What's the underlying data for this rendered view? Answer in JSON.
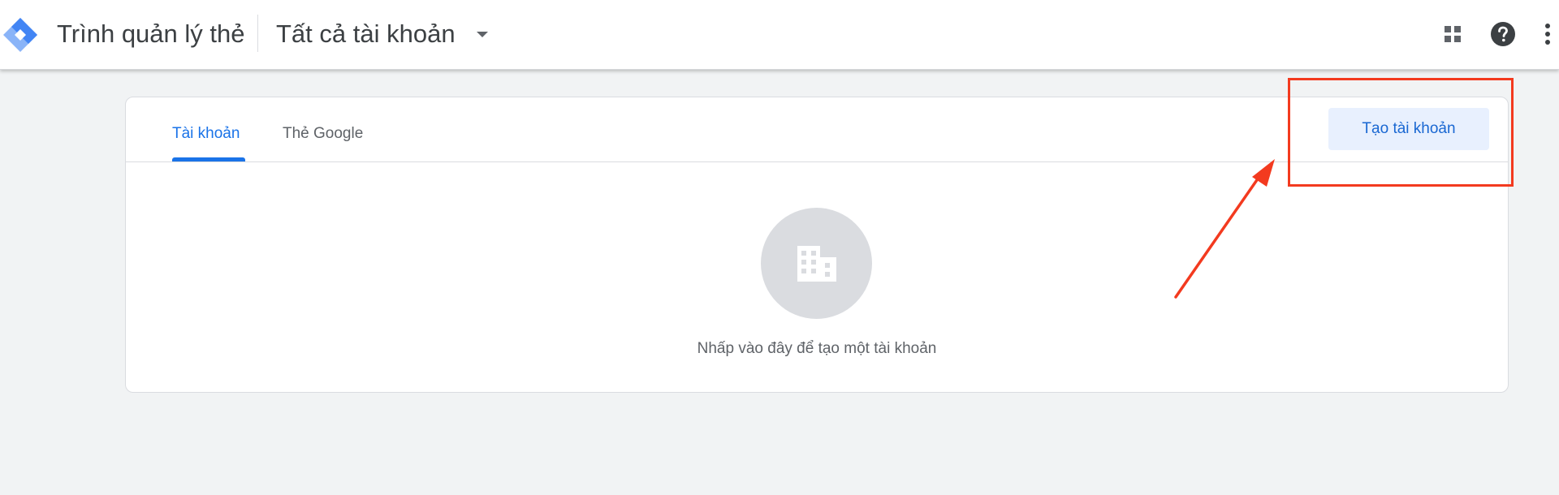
{
  "header": {
    "product_name": "Trình quản lý thẻ",
    "account_selector": "Tất cả tài khoản",
    "icons": [
      "tag-manager-logo-icon",
      "apps-grid-icon",
      "help-icon",
      "more-vert-icon"
    ]
  },
  "tabs": [
    {
      "label": "Tài khoản",
      "active": true
    },
    {
      "label": "Thẻ Google",
      "active": false
    }
  ],
  "create_button": {
    "label": "Tạo tài khoản"
  },
  "empty_state": {
    "icon": "building-icon",
    "message": "Nhấp vào đây để tạo một tài khoản"
  },
  "colors": {
    "accent": "#1a73e8",
    "button_bg": "#e8f0fe",
    "annotation": "#f33a1f",
    "page_bg": "#f1f3f4"
  }
}
